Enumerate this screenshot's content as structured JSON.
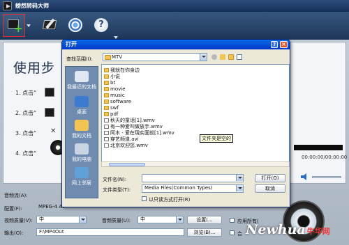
{
  "app": {
    "title": "螃然转码大师"
  },
  "steps": {
    "heading": "使用步",
    "s1": "1. 点击“",
    "s2": "2. 点击“",
    "s3": "3. 点击“",
    "s4": "4. 点击“"
  },
  "right": {
    "time": "00:00:00/00:00:00"
  },
  "form": {
    "audio_label": "音频流(A):",
    "config_label": "配置(F):",
    "config_value": "MPEG-4 AVC 视频格式",
    "video_quality_label": "视频质量(V):",
    "video_quality_value": "中",
    "audio_quality_label": "音频质量(U):",
    "audio_quality_value": "中",
    "settings_button": "设置(...",
    "apply_all_label": "应用所有(",
    "merge_label": "合",
    "output_label": "输出(O):",
    "output_value": "F:\\MP4Out",
    "browse_button": "浏览(B)..."
  },
  "dialog": {
    "title": "打开",
    "look_in_label": "查找范围(I):",
    "look_in_value": "MTV",
    "places": [
      "我最近的文档",
      "桌面",
      "我的文档",
      "我的电脑",
      "网上邻居"
    ],
    "files": [
      {
        "name": "我就在你身边",
        "type": "folder"
      },
      {
        "name": "小说",
        "type": "folder"
      },
      {
        "name": "bt",
        "type": "folder"
      },
      {
        "name": "movie",
        "type": "folder"
      },
      {
        "name": "music",
        "type": "folder"
      },
      {
        "name": "software",
        "type": "folder"
      },
      {
        "name": "swf",
        "type": "folder"
      },
      {
        "name": "pdf",
        "type": "folder"
      },
      {
        "name": "秋天的童话[1].wmv",
        "type": "video"
      },
      {
        "name": "有一种爱叫做放手.wmv",
        "type": "video"
      },
      {
        "name": "阿木 - 爱在現实面前[1].wmv",
        "type": "video"
      },
      {
        "name": "穿艺频道.avi",
        "type": "video"
      },
      {
        "name": "北京欢迎您.wmv",
        "type": "video"
      }
    ],
    "tooltip": "文件夹是空的",
    "filename_label": "文件名(N):",
    "filename_value": "",
    "filetype_label": "文件类型(T):",
    "filetype_value": "Media Files(Common Types)",
    "readonly_label": "以只读方式打开(R)",
    "open_button": "打开(O)",
    "cancel_button": "取消"
  },
  "watermark": {
    "text": "Newhua",
    "cn": "牛华网"
  }
}
